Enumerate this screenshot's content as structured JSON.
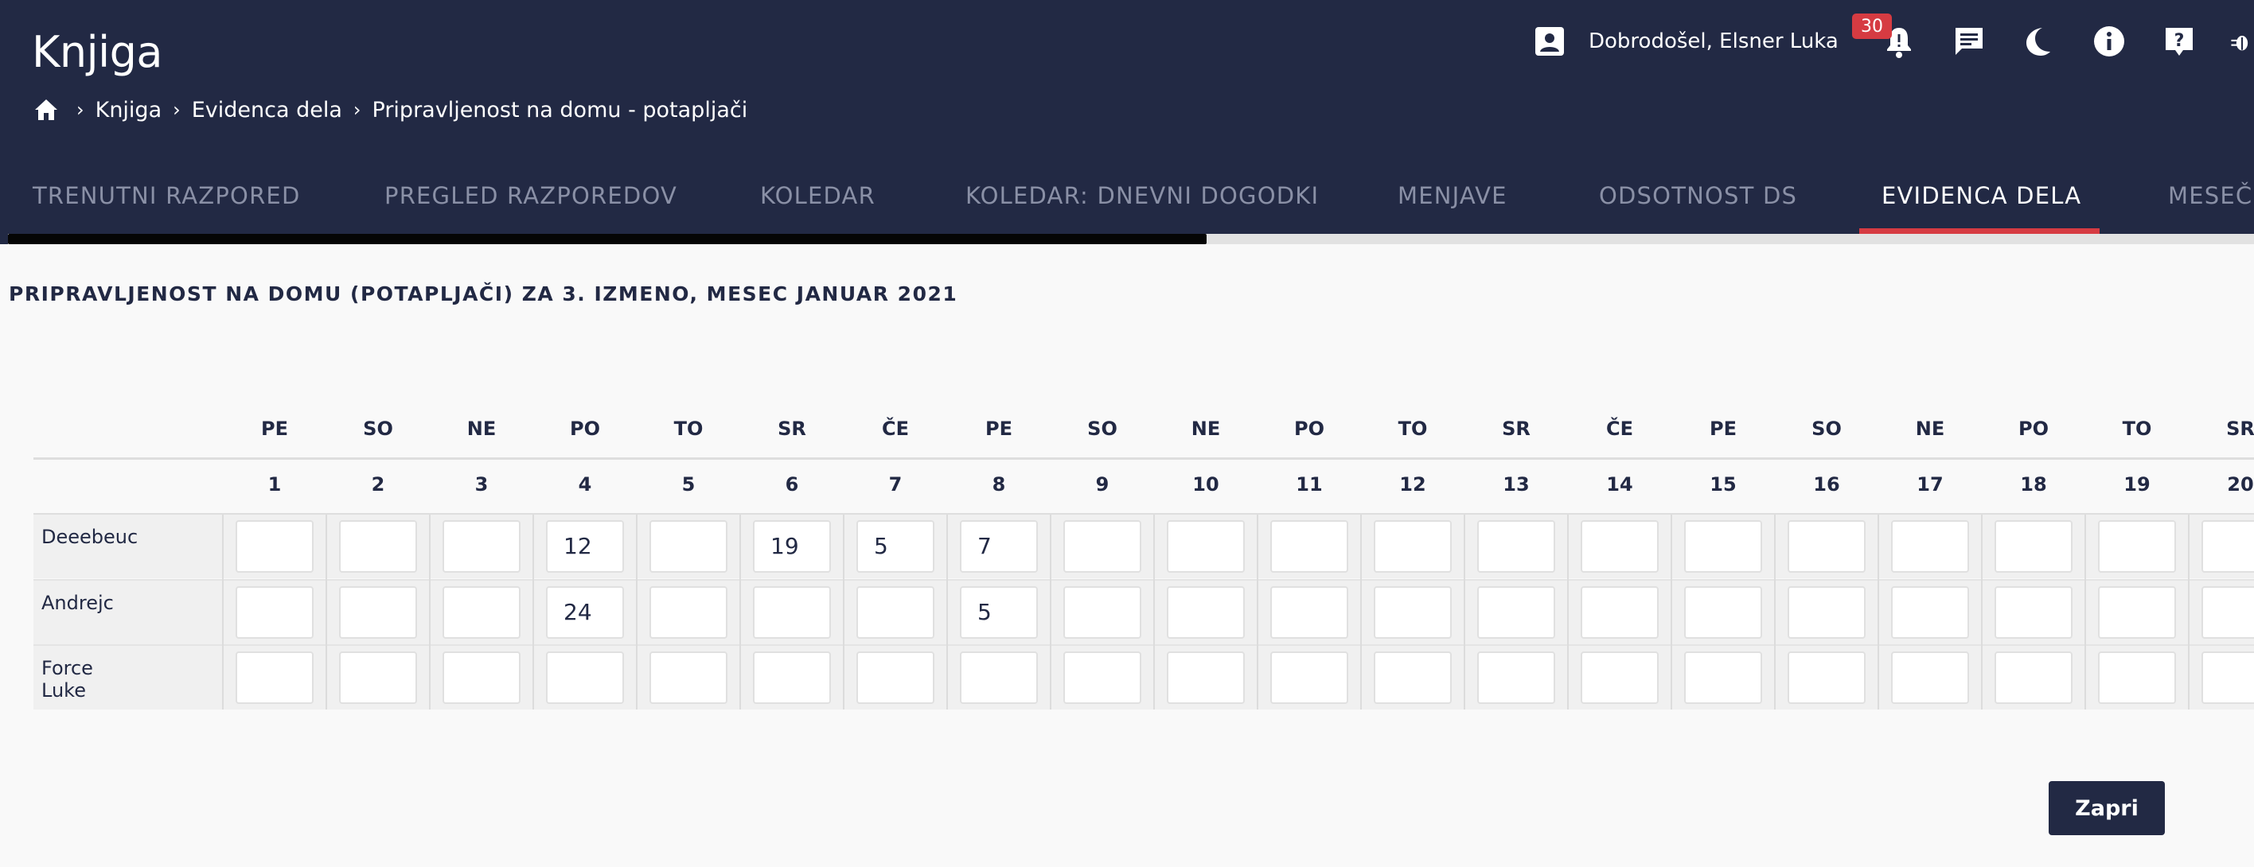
{
  "header": {
    "title": "Knjiga",
    "breadcrumb": [
      "Knjiga",
      "Evidenca dela",
      "Pripravljenost na domu - potapljači"
    ],
    "welcome": "Dobrodošel, Elsner Luka",
    "notification_count": "30",
    "icons": [
      "contact-icon",
      "bell-icon",
      "chat-icon",
      "moon-icon",
      "info-icon",
      "help-icon",
      "bug-icon"
    ]
  },
  "tabs": [
    {
      "label": "TRENUTNI RAZPORED",
      "active": false
    },
    {
      "label": "PREGLED RAZPOREDOV",
      "active": false
    },
    {
      "label": "KOLEDAR",
      "active": false
    },
    {
      "label": "KOLEDAR: DNEVNI DOGODKI",
      "active": false
    },
    {
      "label": "MENJAVE",
      "active": false
    },
    {
      "label": "ODSOTNOST DS",
      "active": false
    },
    {
      "label": "EVIDENCA DELA",
      "active": true
    },
    {
      "label": "MESEČ",
      "active": false
    }
  ],
  "section_title": "PRIPRAVLJENOST NA DOMU (POTAPLJAČI) ZA 3. IZMENO, MESEC JANUAR 2021",
  "table": {
    "day_names": [
      "PE",
      "SO",
      "NE",
      "PO",
      "TO",
      "SR",
      "ČE",
      "PE",
      "SO",
      "NE",
      "PO",
      "TO",
      "SR",
      "ČE",
      "PE",
      "SO",
      "NE",
      "PO",
      "TO",
      "SR"
    ],
    "day_numbers": [
      "1",
      "2",
      "3",
      "4",
      "5",
      "6",
      "7",
      "8",
      "9",
      "10",
      "11",
      "12",
      "13",
      "14",
      "15",
      "16",
      "17",
      "18",
      "19",
      "20"
    ],
    "rows": [
      {
        "name": "Deeebeuc",
        "values": [
          "",
          "",
          "",
          "12",
          "",
          "19",
          "5",
          "7",
          "",
          "",
          "",
          "",
          "",
          "",
          "",
          "",
          "",
          "",
          "",
          ""
        ]
      },
      {
        "name": "Andrejc",
        "values": [
          "",
          "",
          "",
          "24",
          "",
          "",
          "",
          "5",
          "",
          "",
          "",
          "",
          "",
          "",
          "",
          "",
          "",
          "",
          "",
          ""
        ]
      },
      {
        "name": "Force Luke",
        "values": [
          "",
          "",
          "",
          "",
          "",
          "",
          "",
          "",
          "",
          "",
          "",
          "",
          "",
          "",
          "",
          "",
          "",
          "",
          "",
          ""
        ]
      }
    ]
  },
  "close_label": "Zapri",
  "colors": {
    "header_bg": "#222944",
    "accent": "#d63b42",
    "page_bg": "#f9f9f9"
  }
}
